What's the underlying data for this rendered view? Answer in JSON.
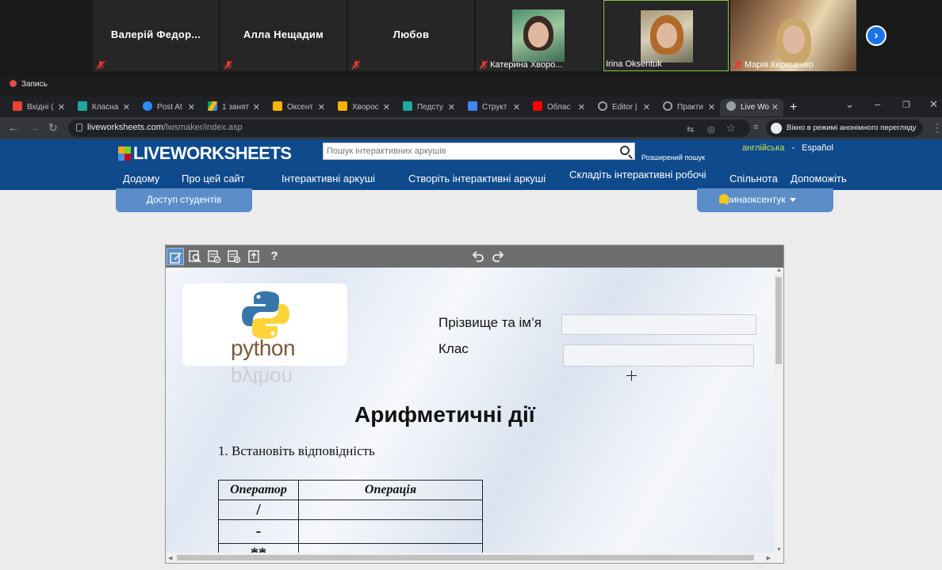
{
  "zoom": {
    "participants": [
      {
        "name": "Валерій  Федор..."
      },
      {
        "name": "Алла Нещадим"
      },
      {
        "name": "Любов"
      },
      {
        "name": "Катерина Хворо..."
      },
      {
        "name": "Irina Oksentuk"
      },
      {
        "name": "Марія Кириченко"
      }
    ],
    "recording_label": "Запись",
    "next_glyph": "›"
  },
  "browser": {
    "tabs": [
      {
        "label": "Вхідні (",
        "color": "#ea4335"
      },
      {
        "label": "Класна",
        "color": "#1fa8a0"
      },
      {
        "label": "Post At",
        "color": "#2d8cff"
      },
      {
        "label": "1 занят",
        "color": "#fbbc04"
      },
      {
        "label": "Оксент",
        "color": "#f4b400"
      },
      {
        "label": "Хворос",
        "color": "#f4b400"
      },
      {
        "label": "Педсту",
        "color": "#1fa8a0"
      },
      {
        "label": "Структ",
        "color": "#4285f4"
      },
      {
        "label": "Облаc",
        "color": "#ff0000"
      },
      {
        "label": "Editor |",
        "color": "#9aa0a6"
      },
      {
        "label": "Практи",
        "color": "#9aa0a6"
      },
      {
        "label": "Live Wo",
        "color": "#9aa0a6"
      }
    ],
    "new_tab": "+",
    "url_host": "liveworksheets.com",
    "url_path": "/lwsmaker/index.asp",
    "incognito_label": "Вікно в режимі анонімного перегляду"
  },
  "site": {
    "logo": "LIVEWORKSHEETS",
    "search_placeholder": "Пошук інтерактивних аркушів",
    "advanced_search": "Розширений пошук",
    "lang_en": "англійська",
    "lang_sep": "-",
    "lang_es": "Español",
    "menu": [
      "Додому",
      "Про цей сайт",
      "Інтерактивні аркуші",
      "Створіть інтерактивні аркуші",
      "Складіть інтерактивні робочі",
      "Спільнота",
      "Допоможіть"
    ],
    "student_access": "Доступ студентів",
    "username": "іринаоксентук"
  },
  "editor": {
    "toolbar_help": "?",
    "python_word": "python",
    "name_label": "Прізвище та ім’я",
    "class_label": "Клас",
    "heading": "Арифметичні дії",
    "task": "1. Встановіть  відповідність",
    "table": {
      "headers": [
        "Оператор",
        "Операція"
      ],
      "rows": [
        [
          "/",
          ""
        ],
        [
          "-",
          ""
        ],
        [
          "**",
          ""
        ]
      ]
    }
  }
}
